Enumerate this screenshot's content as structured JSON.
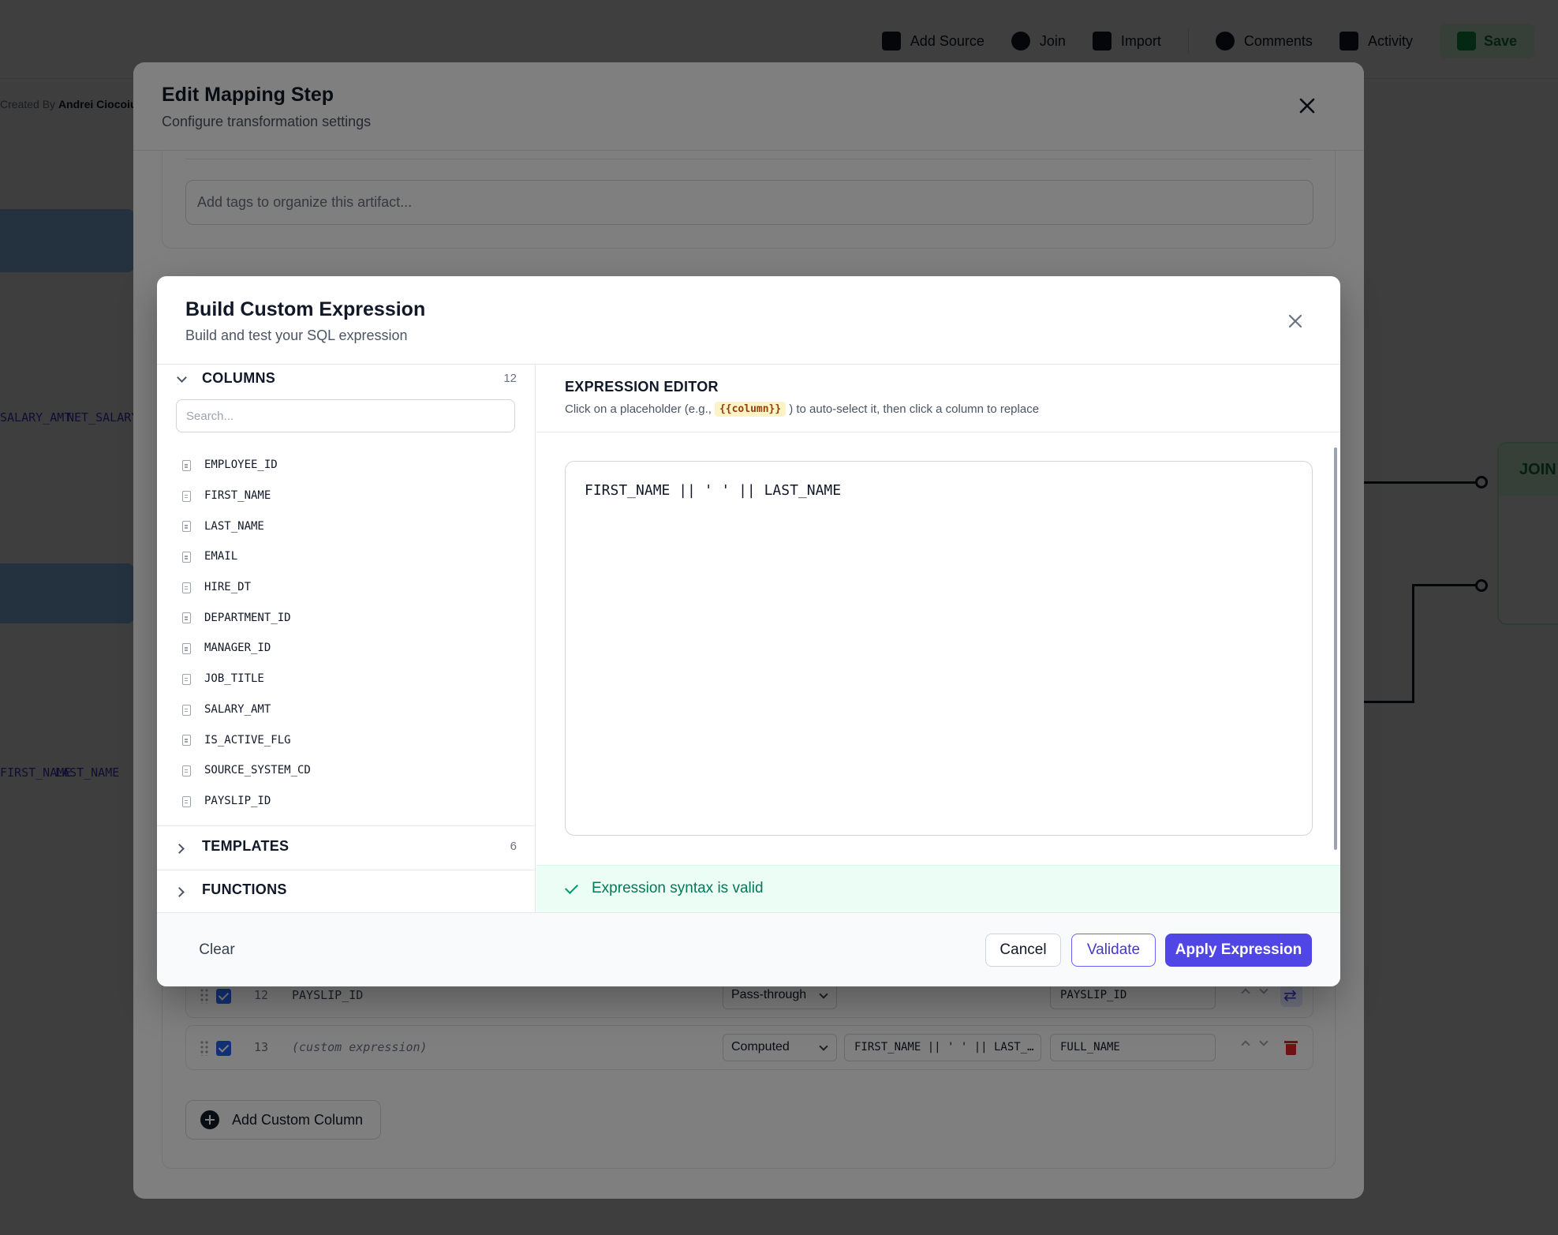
{
  "background": {
    "toolbar": {
      "add_source": "Add Source",
      "join": "Join",
      "import": "Import",
      "comments": "Comments",
      "activity": "Activity",
      "save": "Save"
    },
    "created_by_label": "Created By",
    "created_by_name": "Andrei Ciocoiu",
    "chips": [
      "SALARY_AMT",
      "NET_SALARY",
      "FIRST_NAME",
      "LAST_NAME"
    ],
    "join_node_title": "JOIN"
  },
  "edit_modal": {
    "title": "Edit Mapping Step",
    "subtitle": "Configure transformation settings",
    "tags_placeholder": "Add tags to organize this artifact...",
    "rows": [
      {
        "number": "12",
        "source": "PAYSLIP_ID",
        "mode": "Pass-through",
        "target": "PAYSLIP_ID"
      },
      {
        "number": "13",
        "source": "(custom expression)",
        "mode": "Computed",
        "expression": "FIRST_NAME || ' ' || LAST_NAME",
        "expression_display": "FIRST_NAME || ' ' || LAST_…",
        "target": "FULL_NAME"
      }
    ],
    "add_custom_column": "Add Custom Column"
  },
  "expr_modal": {
    "title": "Build Custom Expression",
    "subtitle": "Build and test your SQL expression",
    "columns_section": {
      "label": "COLUMNS",
      "count": "12",
      "search_placeholder": "Search...",
      "items": [
        "EMPLOYEE_ID",
        "FIRST_NAME",
        "LAST_NAME",
        "EMAIL",
        "HIRE_DT",
        "DEPARTMENT_ID",
        "MANAGER_ID",
        "JOB_TITLE",
        "SALARY_AMT",
        "IS_ACTIVE_FLG",
        "SOURCE_SYSTEM_CD",
        "PAYSLIP_ID"
      ]
    },
    "templates_section": {
      "label": "TEMPLATES",
      "count": "6"
    },
    "functions_section": {
      "label": "FUNCTIONS"
    },
    "editor": {
      "title": "EXPRESSION EDITOR",
      "hint_before": "Click on a placeholder (e.g.,",
      "hint_placeholder": "{{column}}",
      "hint_after": ") to auto-select it, then click a column to replace",
      "value": "FIRST_NAME || ' ' || LAST_NAME"
    },
    "validation_message": "Expression syntax is valid",
    "footer": {
      "clear": "Clear",
      "cancel": "Cancel",
      "validate": "Validate",
      "apply": "Apply Expression"
    }
  },
  "colors": {
    "primary": "#4f46e5",
    "success_text": "#047857",
    "success_bg": "#ecfdf5",
    "danger": "#dc2626",
    "placeholder_bg": "#fef3c7"
  }
}
